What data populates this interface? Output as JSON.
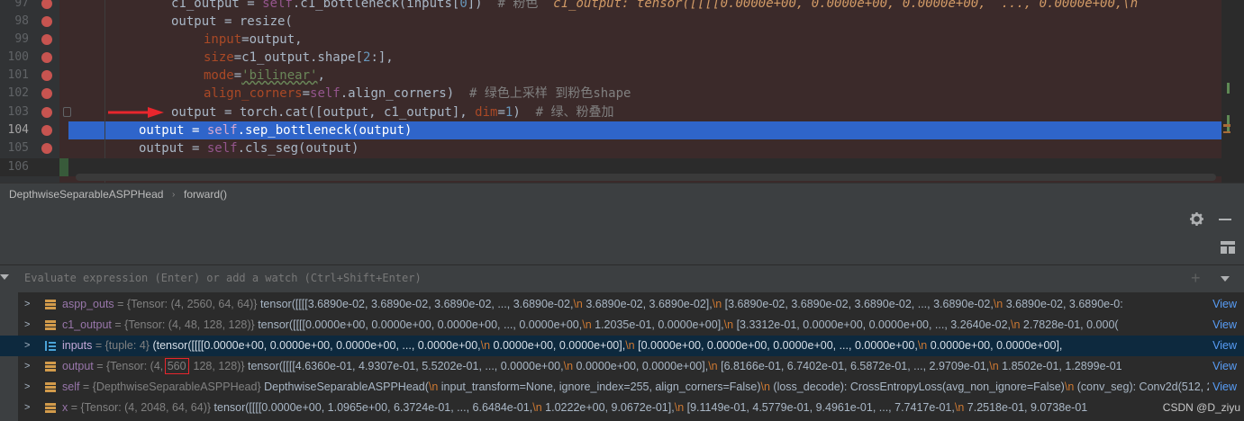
{
  "editor": {
    "lines": [
      {
        "num": "97"
      },
      {
        "num": "98"
      },
      {
        "num": "99"
      },
      {
        "num": "100"
      },
      {
        "num": "101"
      },
      {
        "num": "102"
      },
      {
        "num": "103"
      },
      {
        "num": "104"
      },
      {
        "num": "105"
      },
      {
        "num": "106"
      }
    ],
    "code": {
      "l97_a": "c1_output = ",
      "l97_self": "self",
      "l97_b": ".c1_bottleneck(inputs[",
      "l97_num": "0",
      "l97_c": "])",
      "l97_cm": "  # 粉色",
      "l97_inline": "  c1_output: tensor([[[[0.0000e+00, 0.0000e+00, 0.0000e+00,  ..., 0.0000e+00,\\n",
      "l98": "output = resize(",
      "l99_p": "input",
      "l99_v": "=output,",
      "l100_p": "size",
      "l100_v": "=c1_output.shape[",
      "l100_n": "2",
      "l100_e": ":],",
      "l101_p": "mode",
      "l101_eq": "=",
      "l101_s": "'bilinear'",
      "l101_e": ",",
      "l102_p": "align_corners",
      "l102_eq": "=",
      "l102_self": "self",
      "l102_v": ".align_corners)",
      "l102_cm": "  # 绿色上采样 到粉色shape",
      "l103_a": "output = torch.cat([output, c1_output], ",
      "l103_p": "dim",
      "l103_eq": "=",
      "l103_n": "1",
      "l103_e": ")",
      "l103_cm": "  # 绿、粉叠加",
      "l104_a": "output = ",
      "l104_self": "self",
      "l104_b": ".sep_bottleneck(output)",
      "l105_a": "output = ",
      "l105_self": "self",
      "l105_b": ".cls_seg(output)"
    }
  },
  "breadcrumb": {
    "class_name": "DepthwiseSeparableASPPHead",
    "method": "forward()"
  },
  "evaluate": {
    "placeholder": "Evaluate expression (Enter) or add a watch (Ctrl+Shift+Enter)"
  },
  "variables": [
    {
      "name": "aspp_outs",
      "type": " = {Tensor: (4, 2560, 64, 64)} ",
      "value": "tensor([[[[3.6890e-02, 3.6890e-02, 3.6890e-02,  ..., 3.6890e-02,",
      "nl": "\\n",
      "value2": "          3.6890e-02, 3.6890e-02],",
      "value3": "          [3.6890e-02, 3.6890e-02, 3.6890e-02,  ..., 3.6890e-02,",
      "value4": "          3.6890e-02, 3.6890e-0:",
      "view": "View"
    },
    {
      "name": "c1_output",
      "type": " = {Tensor: (4, 48, 128, 128)} ",
      "value": "tensor([[[[0.0000e+00, 0.0000e+00, 0.0000e+00,  ..., 0.0000e+00,",
      "nl": "\\n",
      "value2": "          1.2035e-01, 0.0000e+00],",
      "value3": "          [3.3312e-01, 0.0000e+00, 0.0000e+00,  ..., 3.2640e-02,",
      "value4": "          2.7828e-01, 0.000(",
      "view": "View"
    },
    {
      "name": "inputs",
      "type": " = {tuple: 4} ",
      "value": "(tensor([[[[0.0000e+00, 0.0000e+00, 0.0000e+00,  ..., 0.0000e+00,",
      "nl": "\\n",
      "value2": "          0.0000e+00, 0.0000e+00],",
      "value3": "          [0.0000e+00, 0.0000e+00, 0.0000e+00,  ..., 0.0000e+00,",
      "value4": "          0.0000e+00, 0.0000e+00],",
      "view": "View"
    },
    {
      "name": "output",
      "type_pre": " = {Tensor: (4, ",
      "type_box": "560",
      "type_post": ", 128, 128)} ",
      "value": "tensor([[[[4.6360e-01, 4.9307e-01, 5.5202e-01,  ..., 0.0000e+00,",
      "nl": "\\n",
      "value2": "          0.0000e+00, 0.0000e+00],",
      "value3": "          [6.8166e-01, 6.7402e-01, 6.5872e-01,  ..., 2.9709e-01,",
      "value4": "          1.8502e-01, 1.2899e-01",
      "view": "View"
    },
    {
      "name": "self",
      "type": " = {DepthwiseSeparableASPPHead} ",
      "value": "DepthwiseSeparableASPPHead(",
      "nl": "\\n",
      "value2": "  input_transform=None, ignore_index=255, align_corners=False)",
      "value3": "  (loss_decode): CrossEntropyLoss(avg_non_ignore=False)",
      "value4": "  (conv_seg): Conv2d(512, 2,",
      "view": "View"
    },
    {
      "name": "x",
      "type": " = {Tensor: (4, 2048, 64, 64)} ",
      "value": "tensor([[[[0.0000e+00, 1.0965e+00, 6.3724e-01,  ..., 6.6484e-01,",
      "nl": "\\n",
      "value2": "          1.0222e+00, 9.0672e-01],",
      "value3": "          [9.1149e-01, 4.5779e-01, 9.4961e-01,  ..., 7.7417e-01,",
      "value4": "          7.2518e-01, 9.0738e-01",
      "view": "View"
    }
  ],
  "watermark": "CSDN @D_ziyu",
  "colors": {
    "breakpoint": "#c75450",
    "current_line": "#2f65ca",
    "annotation_arrow": "#e8262d"
  }
}
